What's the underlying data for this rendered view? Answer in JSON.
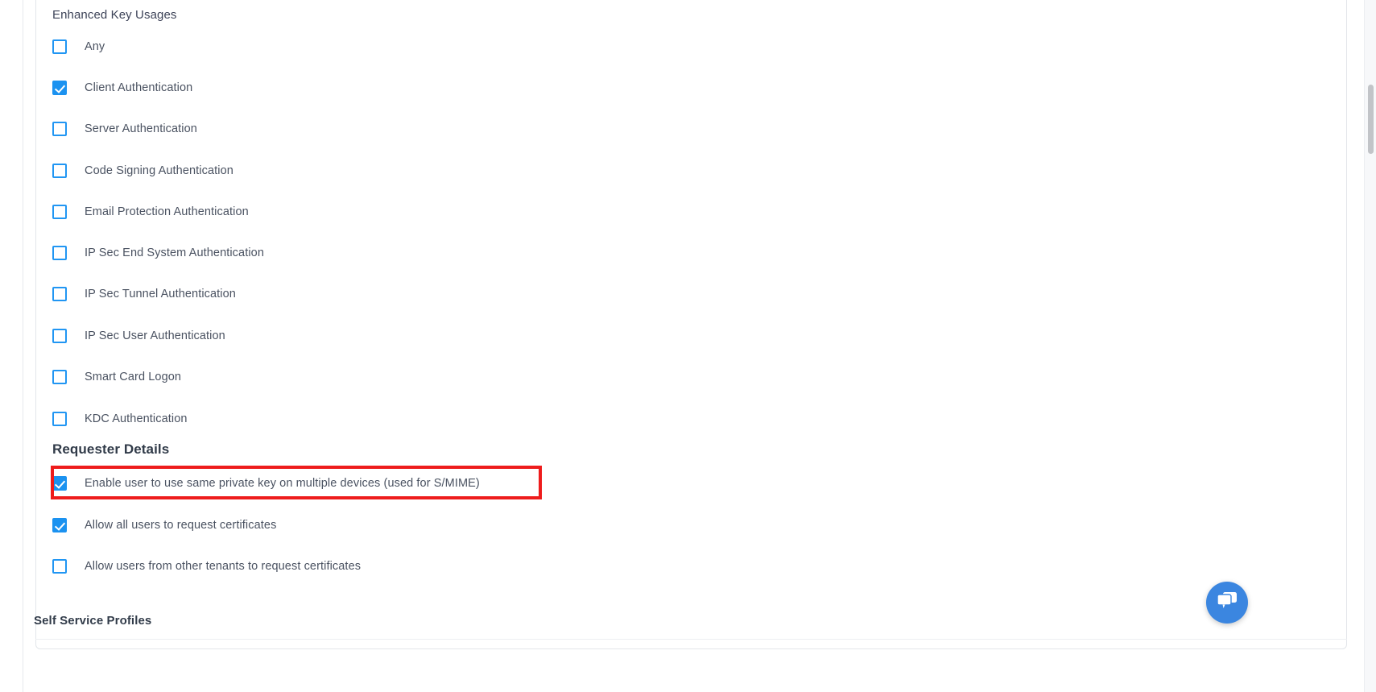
{
  "card": {
    "sections": [
      {
        "id": "enhanced-key-usages",
        "title": "Enhanced Key Usages",
        "options": [
          {
            "label": "Any",
            "checked": false
          },
          {
            "label": "Client Authentication",
            "checked": true
          },
          {
            "label": "Server Authentication",
            "checked": false
          },
          {
            "label": "Code Signing Authentication",
            "checked": false
          },
          {
            "label": "Email Protection Authentication",
            "checked": false
          },
          {
            "label": "IP Sec End System Authentication",
            "checked": false
          },
          {
            "label": "IP Sec Tunnel Authentication",
            "checked": false
          },
          {
            "label": "IP Sec User Authentication",
            "checked": false
          },
          {
            "label": "Smart Card Logon",
            "checked": false
          },
          {
            "label": "KDC Authentication",
            "checked": false
          }
        ]
      },
      {
        "id": "requester-details",
        "title": "Requester Details",
        "options": [
          {
            "label": "Enable user to use same private key on multiple devices (used for S/MIME)",
            "checked": true,
            "highlighted": true
          },
          {
            "label": "Allow all users to request certificates",
            "checked": true
          },
          {
            "label": "Allow users from other tenants to request certificates",
            "checked": false
          }
        ]
      }
    ]
  },
  "below": {
    "title": "Self Service Profiles"
  },
  "widgets": {
    "chat_icon": "chat-bubble-icon"
  },
  "colors": {
    "accent": "#1b92f0",
    "highlight": "#ee1c1c",
    "chat_fab": "#3b86e0",
    "text": "#4a5261",
    "heading": "#313b49"
  }
}
